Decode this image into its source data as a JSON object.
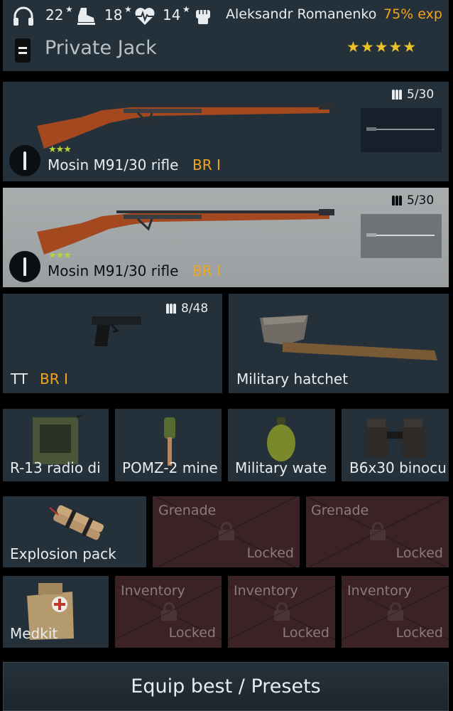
{
  "header": {
    "stat1_value": "22",
    "stat2_value": "18",
    "stat3_value": "14",
    "player_name": "Aleksandr Romanenko",
    "exp_text": "75% exp",
    "rank_title": "Private Jack",
    "rating_stars": 5
  },
  "primary_weapons": [
    {
      "name": "Mosin M91/30 rifle",
      "br": "BR I",
      "ammo": "5/30",
      "quality_stars": 3
    },
    {
      "name": "Mosin M91/30 rifle",
      "br": "BR I",
      "ammo": "5/30",
      "quality_stars": 3
    }
  ],
  "sidearm": {
    "name": "TT",
    "br": "BR I",
    "ammo": "8/48"
  },
  "melee": {
    "name": "Military hatchet"
  },
  "equipment": [
    {
      "name": "R-13 radio di"
    },
    {
      "name": "POMZ-2 mine"
    },
    {
      "name": "Military wate"
    },
    {
      "name": "B6x30 binocu"
    }
  ],
  "grenade_row": {
    "explosive": {
      "name": "Explosion pack"
    },
    "slots": [
      {
        "caption": "Grenade",
        "status": "Locked"
      },
      {
        "caption": "Grenade",
        "status": "Locked"
      }
    ]
  },
  "inventory_row": {
    "item": {
      "name": "Medkit"
    },
    "slots": [
      {
        "caption": "Inventory",
        "status": "Locked"
      },
      {
        "caption": "Inventory",
        "status": "Locked"
      },
      {
        "caption": "Inventory",
        "status": "Locked"
      }
    ]
  },
  "footer": {
    "button_label": "Equip best / Presets"
  },
  "colors": {
    "accent_orange": "#f2a41a",
    "panel": "#24313b",
    "locked_slot": "#3a2225",
    "selected_slot": "#a3a8aa"
  }
}
